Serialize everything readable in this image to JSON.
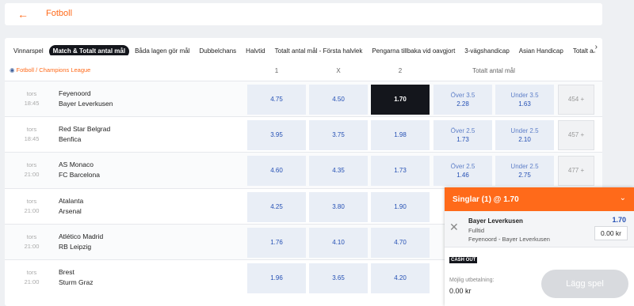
{
  "header": {
    "back_icon": "←",
    "title": "Fotboll"
  },
  "tabs": [
    "Vinnarspel",
    "Match & Totalt antal mål",
    "Båda lagen gör mål",
    "Dubbelchans",
    "Halvtid",
    "Totalt antal mål - Första halvlek",
    "Pengarna tillbaka vid oavgjort",
    "3-vägshandicap",
    "Asian Handicap",
    "Totalt antal mål"
  ],
  "active_tab": "Match & Totalt antal mål",
  "tabs_arrow": "›",
  "league": "Fotboll / Champions League",
  "columns": {
    "one": "1",
    "x": "X",
    "two": "2",
    "total": "Totalt antal mål"
  },
  "matches": [
    {
      "day": "tors",
      "time": "18:45",
      "home": "Feyenoord",
      "away": "Bayer Leverkusen",
      "o1": "4.75",
      "ox": "4.50",
      "o2": "1.70",
      "over_label": "Över 3.5",
      "over": "2.28",
      "under_label": "Under 3.5",
      "under": "1.63",
      "more": "454 +"
    },
    {
      "day": "tors",
      "time": "18:45",
      "home": "Red Star Belgrad",
      "away": "Benfica",
      "o1": "3.95",
      "ox": "3.75",
      "o2": "1.98",
      "over_label": "Över 2.5",
      "over": "1.73",
      "under_label": "Under 2.5",
      "under": "2.10",
      "more": "457 +"
    },
    {
      "day": "tors",
      "time": "21:00",
      "home": "AS Monaco",
      "away": "FC Barcelona",
      "o1": "4.60",
      "ox": "4.35",
      "o2": "1.73",
      "over_label": "Över 2.5",
      "over": "1.46",
      "under_label": "Under 2.5",
      "under": "2.75",
      "more": "477 +"
    },
    {
      "day": "tors",
      "time": "21:00",
      "home": "Atalanta",
      "away": "Arsenal",
      "o1": "4.25",
      "ox": "3.80",
      "o2": "1.90"
    },
    {
      "day": "tors",
      "time": "21:00",
      "home": "Atlético Madrid",
      "away": "RB Leipzig",
      "o1": "1.76",
      "ox": "4.10",
      "o2": "4.70"
    },
    {
      "day": "tors",
      "time": "21:00",
      "home": "Brest",
      "away": "Sturm Graz",
      "o1": "1.96",
      "ox": "3.65",
      "o2": "4.20"
    }
  ],
  "betslip": {
    "title": "Singlar (1) @ 1.70",
    "chevron": "⌄",
    "remove_icon": "✕",
    "selection": "Bayer Leverkusen",
    "market": "Fulltid",
    "match": "Feyenoord - Bayer Leverkusen",
    "odds": "1.70",
    "stake": "0.00 kr",
    "cashout": "CASH OUT",
    "payout_label": "Möjlig utbetalning:",
    "payout_value": "0.00 kr",
    "place_label": "Lägg spel"
  },
  "colors": {
    "accent": "#ff6a1a",
    "odds_text": "#2550b4",
    "selected_bg": "#14161c",
    "odds_bg": "#e9eef6"
  }
}
